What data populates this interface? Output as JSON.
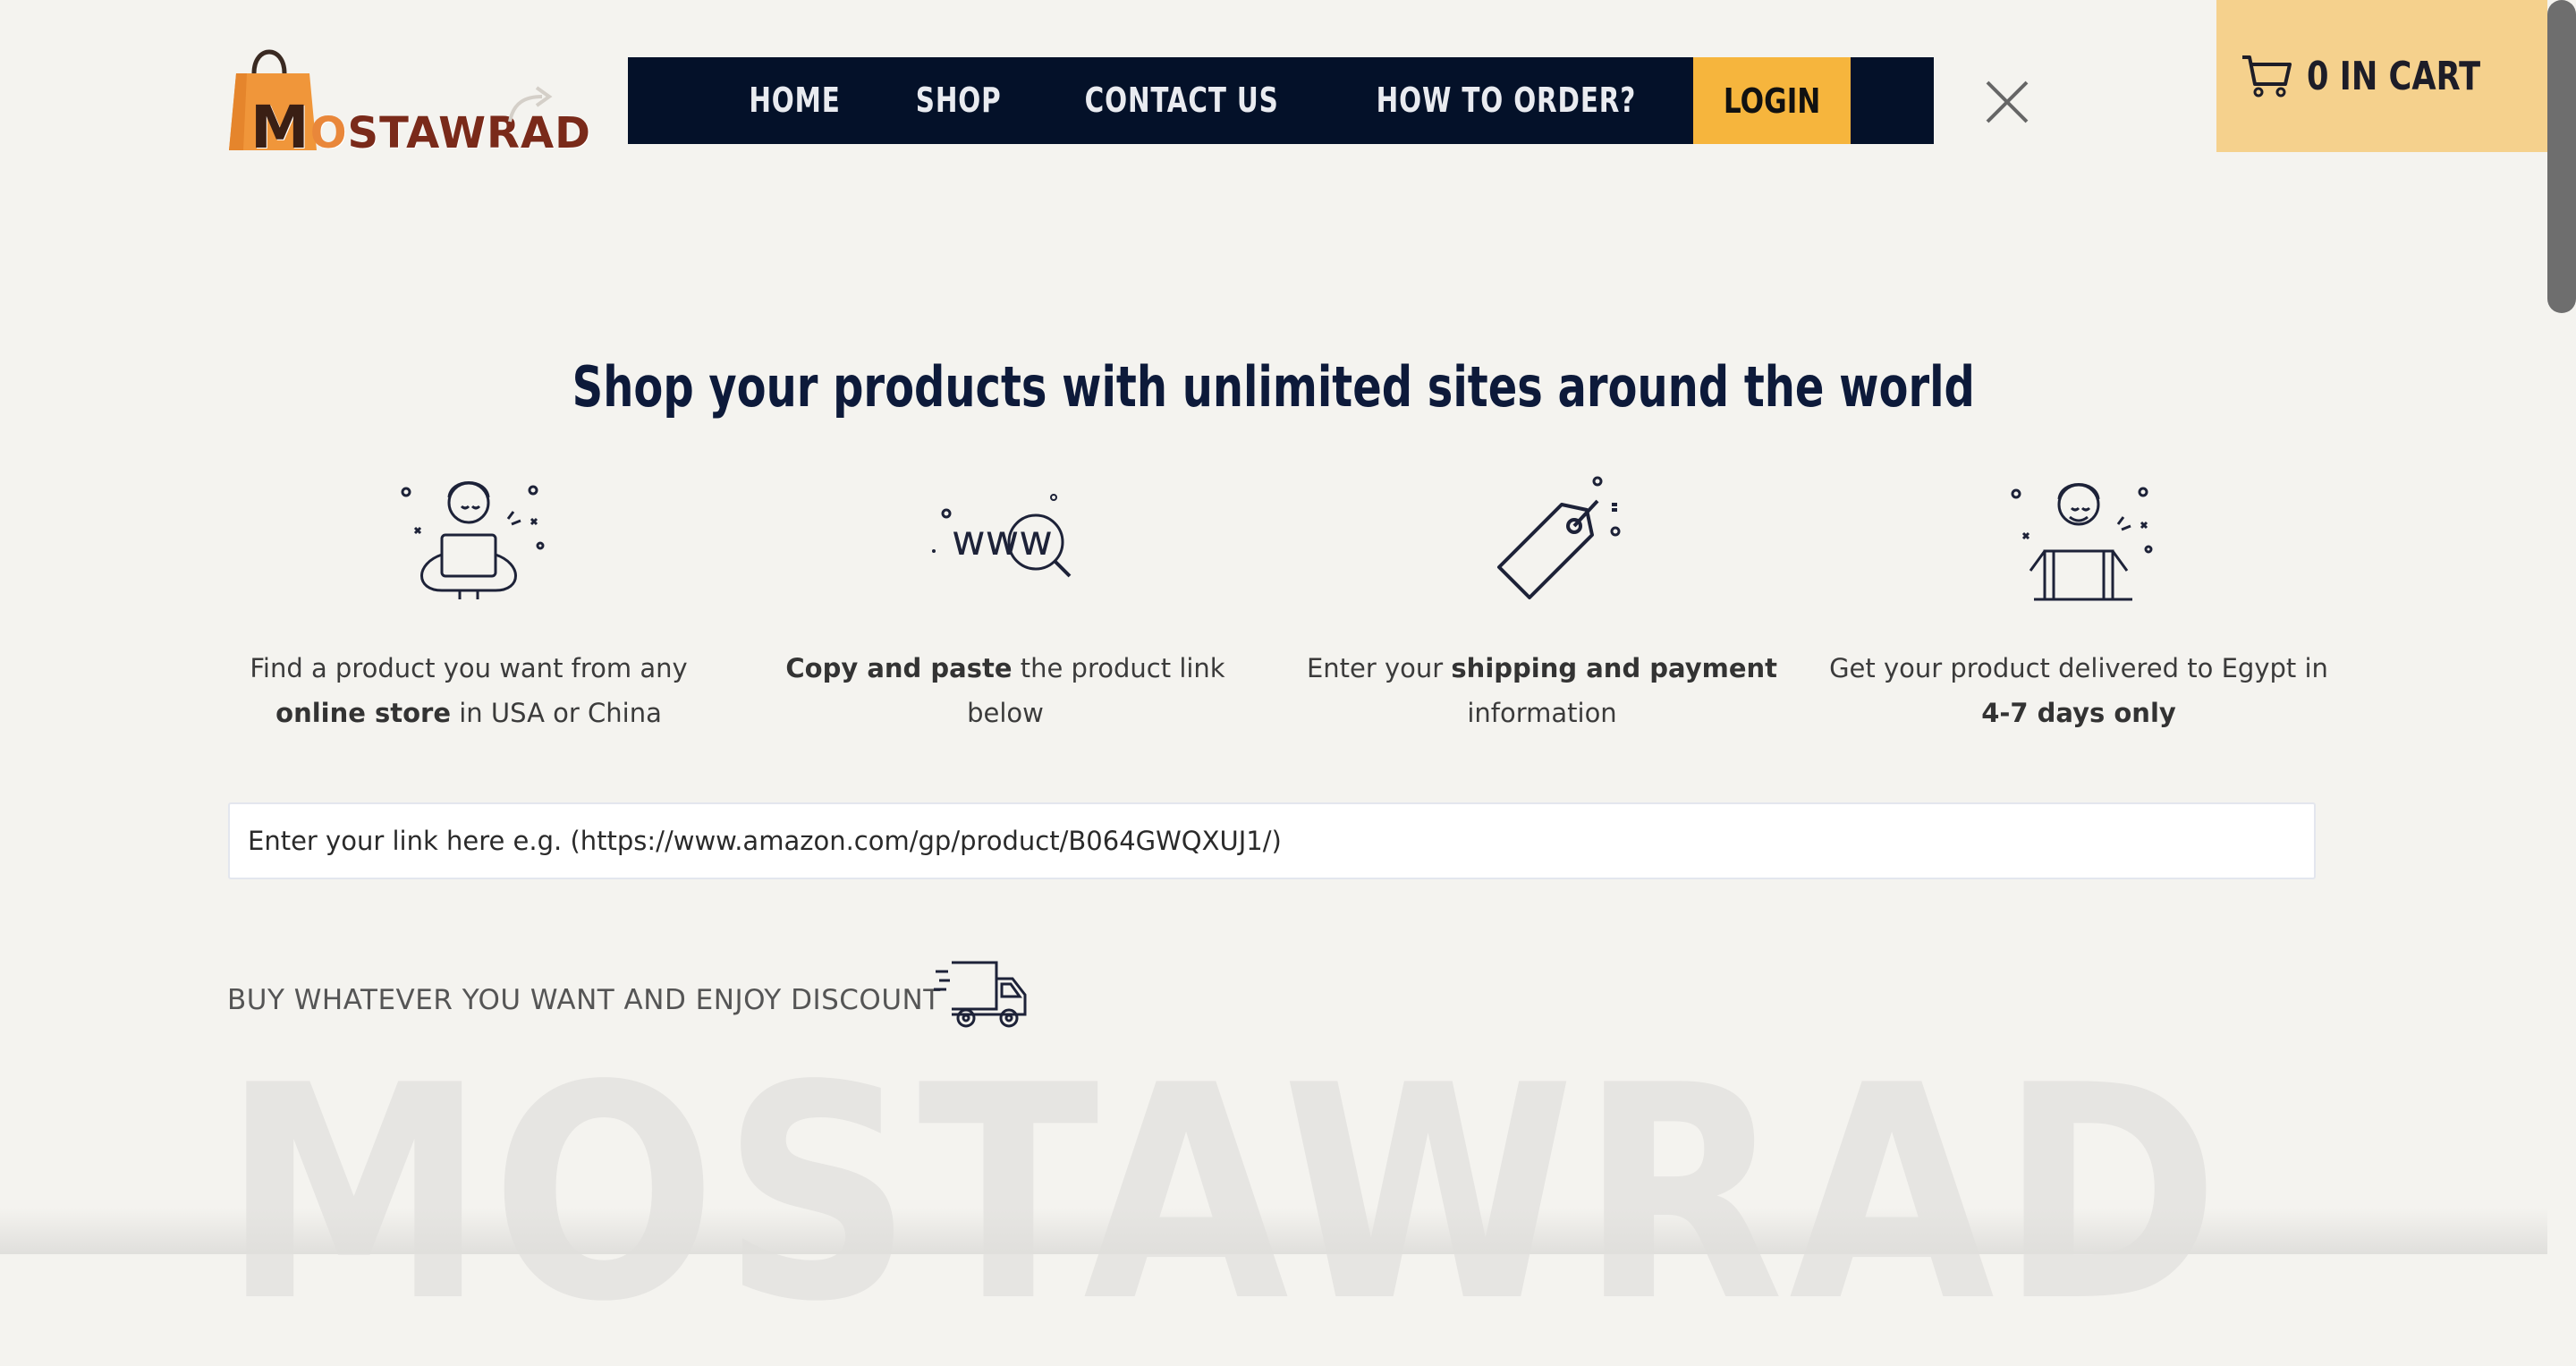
{
  "brand": {
    "name": "MOSTAWRAD",
    "first_letter": "M",
    "o_letter": "O",
    "rest": "STAWRAD"
  },
  "nav": {
    "items": [
      {
        "label": "HOME"
      },
      {
        "label": "SHOP"
      },
      {
        "label": "CONTACT US"
      },
      {
        "label": "HOW TO ORDER?"
      }
    ],
    "login_label": "LOGIN"
  },
  "cart": {
    "label": "0 IN CART",
    "count": 0
  },
  "headline": "Shop your products with unlimited sites around the world",
  "steps": [
    {
      "icon": "person-with-laptop-icon",
      "pre": "Find a product you want from any ",
      "bold": "online store",
      "post": " in USA or China"
    },
    {
      "icon": "www-search-icon",
      "pre": "",
      "bold": "Copy and paste",
      "post": " the product link below"
    },
    {
      "icon": "price-tag-icon",
      "pre": "Enter your ",
      "bold": "shipping and payment",
      "post": " information"
    },
    {
      "icon": "person-in-box-icon",
      "pre": "Get your product delivered to Egypt in ",
      "bold": "4-7 days only",
      "post": ""
    }
  ],
  "link_input": {
    "placeholder": "Enter your link here e.g. (https://www.amazon.com/gp/product/B064GWQXUJ1/)"
  },
  "promo": "BUY WHATEVER YOU WANT AND ENJOY DISCOUNT",
  "watermark": "MOSTAWRAD",
  "colors": {
    "nav_bg": "#041129",
    "accent": "#f6b53d",
    "cart_bg": "#f5d18d",
    "page_bg": "#f4f3ef",
    "headline": "#0d1a3a"
  }
}
